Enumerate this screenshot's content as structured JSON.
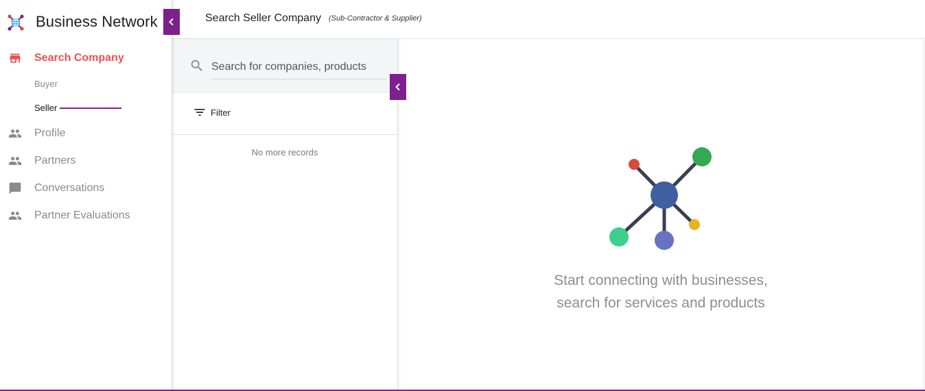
{
  "app": {
    "title": "Business Network",
    "brand_color": "#7e1f8e",
    "accent_color": "#ef4f55"
  },
  "sidebar": {
    "collapse_icon": "chevron-left-icon",
    "items": [
      {
        "label": "Search Company",
        "icon": "store-icon",
        "active": true
      },
      {
        "label": "Profile",
        "icon": "people-icon"
      },
      {
        "label": "Partners",
        "icon": "people-icon"
      },
      {
        "label": "Conversations",
        "icon": "chat-icon"
      },
      {
        "label": "Partner Evaluations",
        "icon": "people-icon"
      }
    ],
    "sub_items": [
      {
        "label": "Buyer"
      },
      {
        "label": "Seller",
        "active": true
      }
    ]
  },
  "header": {
    "title": "Search Seller Company",
    "subtitle": "(Sub-Contractor & Supplier)"
  },
  "list_panel": {
    "search_placeholder": "Search for companies, products",
    "filter_label": "Filter",
    "empty_text": "No more records"
  },
  "main": {
    "empty_line1": "Start connecting with businesses,",
    "empty_line2": "search for services and products",
    "illustration_colors": {
      "hub": "#3f5fa0",
      "red": "#d94a3d",
      "green": "#35a853",
      "teal": "#3ecf8e",
      "purple": "#6674bf",
      "yellow": "#e8b320",
      "line": "#3a3f52"
    }
  }
}
